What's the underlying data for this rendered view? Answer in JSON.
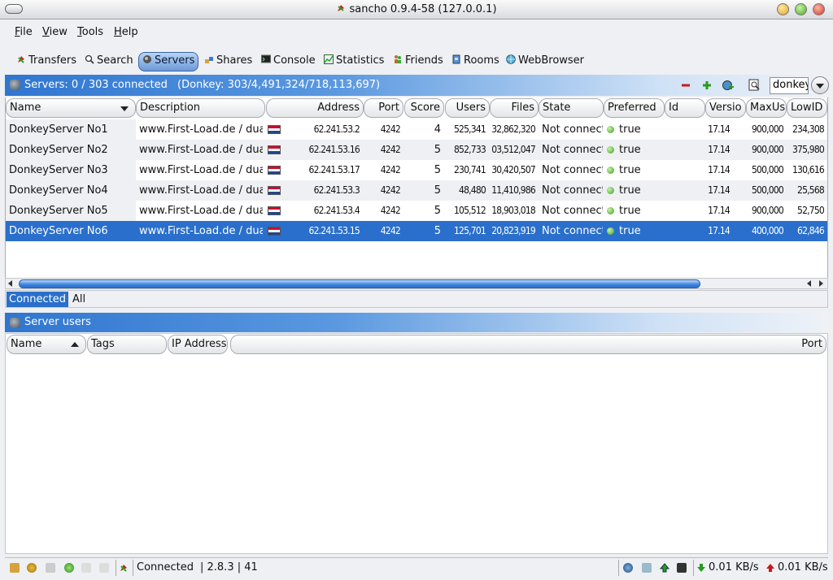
{
  "window": {
    "title": "sancho 0.9.4-58 (127.0.0.1)"
  },
  "menu": [
    {
      "label": "File",
      "key": "F",
      "rest": "ile"
    },
    {
      "label": "View",
      "key": "V",
      "rest": "iew"
    },
    {
      "label": "Tools",
      "key": "T",
      "rest": "ools"
    },
    {
      "label": "Help",
      "key": "H",
      "rest": "elp"
    }
  ],
  "tabs": [
    {
      "label": "Transfers",
      "icon": "transfers-icon"
    },
    {
      "label": "Search",
      "icon": "search-icon"
    },
    {
      "label": "Servers",
      "icon": "servers-icon",
      "active": true
    },
    {
      "label": "Shares",
      "icon": "shares-icon"
    },
    {
      "label": "Console",
      "icon": "console-icon"
    },
    {
      "label": "Statistics",
      "icon": "statistics-icon"
    },
    {
      "label": "Friends",
      "icon": "friends-icon"
    },
    {
      "label": "Rooms",
      "icon": "rooms-icon"
    },
    {
      "label": "WebBrowser",
      "icon": "web-browser-icon"
    }
  ],
  "servers_panel": {
    "header": "Servers: 0 / 303 connected",
    "network_info": "(Donkey: 303/4,491,324/718,113,697)",
    "filter_value": "donkey",
    "columns": [
      "Name",
      "Description",
      "Address",
      "Port",
      "Score",
      "Users",
      "Files",
      "State",
      "Preferred",
      "Id",
      "Versio",
      "MaxUs",
      "LowID"
    ],
    "rows": [
      {
        "name": "DonkeyServer No1",
        "description": "www.First-Load.de / dual",
        "address": "62.241.53.2",
        "port": "4242",
        "score": "4",
        "users": "525,341",
        "files": "32,862,320",
        "state": "Not connect",
        "preferred": "true",
        "id": "",
        "version": "17.14",
        "maxusers": "900,000",
        "lowid": "234,308"
      },
      {
        "name": "DonkeyServer No2",
        "description": "www.First-Load.de / dual",
        "address": "62.241.53.16",
        "port": "4242",
        "score": "5",
        "users": "852,733",
        "files": "03,512,047",
        "state": "Not connect",
        "preferred": "true",
        "id": "",
        "version": "17.14",
        "maxusers": "900,000",
        "lowid": "375,980"
      },
      {
        "name": "DonkeyServer No3",
        "description": "www.First-Load.de / dual",
        "address": "62.241.53.17",
        "port": "4242",
        "score": "5",
        "users": "230,741",
        "files": "30,420,507",
        "state": "Not connect",
        "preferred": "true",
        "id": "",
        "version": "17.14",
        "maxusers": "500,000",
        "lowid": "130,616"
      },
      {
        "name": "DonkeyServer No4",
        "description": "www.First-Load.de / dual",
        "address": "62.241.53.3",
        "port": "4242",
        "score": "5",
        "users": "48,480",
        "files": "11,410,986",
        "state": "Not connect",
        "preferred": "true",
        "id": "",
        "version": "17.14",
        "maxusers": "500,000",
        "lowid": "25,568"
      },
      {
        "name": "DonkeyServer No5",
        "description": "www.First-Load.de / dual",
        "address": "62.241.53.4",
        "port": "4242",
        "score": "5",
        "users": "105,512",
        "files": "18,903,018",
        "state": "Not connect",
        "preferred": "true",
        "id": "",
        "version": "17.14",
        "maxusers": "900,000",
        "lowid": "52,750"
      },
      {
        "name": "DonkeyServer No6",
        "description": "www.First-Load.de / dual",
        "address": "62.241.53.15",
        "port": "4242",
        "score": "5",
        "users": "125,701",
        "files": "20,823,919",
        "state": "Not connect",
        "preferred": "true",
        "id": "",
        "version": "17.14",
        "maxusers": "400,000",
        "lowid": "62,846",
        "selected": true
      }
    ],
    "subtabs": [
      {
        "label": "Connected",
        "active": true
      },
      {
        "label": "All"
      }
    ]
  },
  "users_panel": {
    "header": "Server users",
    "columns": [
      "Name",
      "Tags",
      "IP Address",
      "Port"
    ]
  },
  "status": {
    "connection": "Connected",
    "version_info": "| 2.8.3 | 41",
    "download_rate": "0.01 KB/s",
    "upload_rate": "0.01 KB/s"
  },
  "colors": {
    "selection": "#2a6fcb",
    "header_gradient_start": "#2f76d0",
    "status_ok": "#3b9e22",
    "down_arrow": "#2a9a20",
    "up_arrow": "#c81818"
  }
}
